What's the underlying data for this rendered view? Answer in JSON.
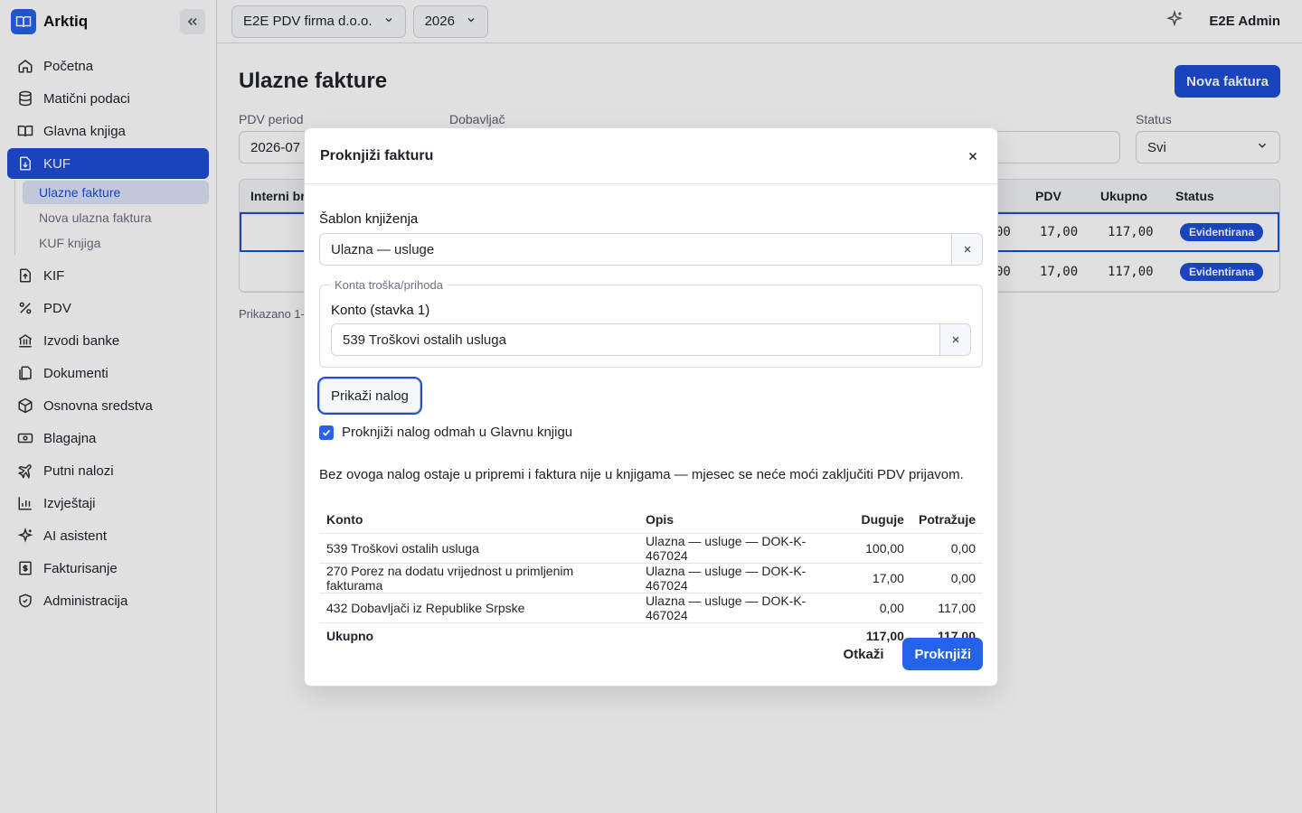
{
  "app": {
    "name": "Arktiq"
  },
  "sidebar": {
    "items": [
      {
        "label": "Početna",
        "icon": "home-icon"
      },
      {
        "label": "Matični podaci",
        "icon": "database-icon"
      },
      {
        "label": "Glavna knjiga",
        "icon": "book-icon"
      },
      {
        "label": "KUF",
        "icon": "file-in-icon"
      },
      {
        "label": "KIF",
        "icon": "file-out-icon"
      },
      {
        "label": "PDV",
        "icon": "percent-icon"
      },
      {
        "label": "Izvodi banke",
        "icon": "bank-icon"
      },
      {
        "label": "Dokumenti",
        "icon": "documents-icon"
      },
      {
        "label": "Osnovna sredstva",
        "icon": "package-icon"
      },
      {
        "label": "Blagajna",
        "icon": "cash-icon"
      },
      {
        "label": "Putni nalozi",
        "icon": "plane-icon"
      },
      {
        "label": "Izvještaji",
        "icon": "chart-icon"
      },
      {
        "label": "AI asistent",
        "icon": "sparkle-icon"
      },
      {
        "label": "Fakturisanje",
        "icon": "invoice-icon"
      },
      {
        "label": "Administracija",
        "icon": "shield-icon"
      }
    ],
    "kuf_sub": [
      {
        "label": "Ulazne fakture"
      },
      {
        "label": "Nova ulazna faktura"
      },
      {
        "label": "KUF knjiga"
      }
    ]
  },
  "header": {
    "company": "E2E PDV firma d.o.o.",
    "year": "2026",
    "user": "E2E Admin"
  },
  "page": {
    "title": "Ulazne fakture",
    "new_button": "Nova faktura",
    "filters": {
      "period_label": "PDV period",
      "period_value": "2026-07",
      "supplier_label": "Dobavljač",
      "status_label": "Status",
      "status_value": "Svi"
    },
    "table": {
      "col_internal": "Interni br",
      "col_pdv": "PDV",
      "col_total": "Ukupno",
      "col_status": "Status",
      "rows": [
        {
          "base_tail": "00",
          "pdv": "17,00",
          "total": "117,00",
          "status": "Evidentirana"
        },
        {
          "base_tail": "00",
          "pdv": "17,00",
          "total": "117,00",
          "status": "Evidentirana"
        }
      ]
    },
    "showing": "Prikazano 1-"
  },
  "modal": {
    "title": "Proknjiži fakturu",
    "template_label": "Šablon knjiženja",
    "template_value": "Ulazna — usluge",
    "fieldset_legend": "Konta troška/prihoda",
    "account_label": "Konto (stavka 1)",
    "account_value": "539 Troškovi ostalih usluga",
    "show_order_button": "Prikaži nalog",
    "post_now_label": "Proknjiži nalog odmah u Glavnu knjigu",
    "note": "Bez ovoga nalog ostaje u pripremi i faktura nije u knjigama — mjesec se neće moći zaključiti PDV prijavom.",
    "columns": {
      "account": "Konto",
      "description": "Opis",
      "debit": "Duguje",
      "credit": "Potražuje"
    },
    "lines": [
      {
        "account": "539 Troškovi ostalih usluga",
        "description": "Ulazna — usluge — DOK-K-467024",
        "debit": "100,00",
        "credit": "0,00"
      },
      {
        "account": "270 Porez na dodatu vrijednost u primljenim fakturama",
        "description": "Ulazna — usluge — DOK-K-467024",
        "debit": "17,00",
        "credit": "0,00"
      },
      {
        "account": "432 Dobavljači iz Republike Srpske",
        "description": "Ulazna — usluge — DOK-K-467024",
        "debit": "0,00",
        "credit": "117,00"
      }
    ],
    "total": {
      "label": "Ukupno",
      "debit": "117,00",
      "credit": "117,00"
    },
    "cancel_button": "Otkaži",
    "post_button": "Proknjiži"
  }
}
